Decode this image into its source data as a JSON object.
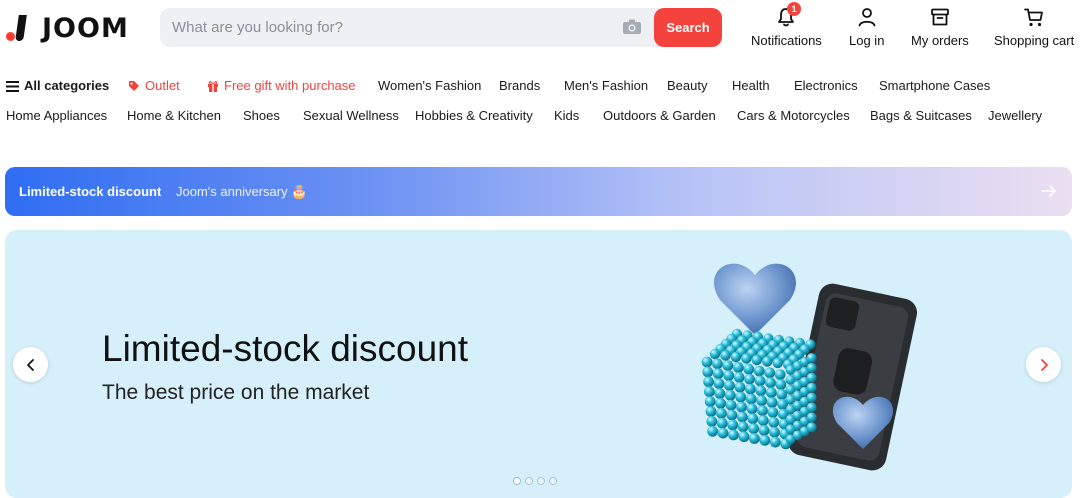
{
  "header": {
    "logo_text": "JOOM",
    "search": {
      "placeholder": "What are you looking for?",
      "button_label": "Search"
    },
    "actions": [
      {
        "label": "Notifications",
        "icon": "bell-icon",
        "badge": "1"
      },
      {
        "label": "Log in",
        "icon": "user-icon"
      },
      {
        "label": "My orders",
        "icon": "box-icon"
      },
      {
        "label": "Shopping cart",
        "icon": "cart-icon"
      }
    ]
  },
  "nav": {
    "row1": [
      {
        "label": "All categories",
        "icon": "menu-icon",
        "style": "bold"
      },
      {
        "label": "Outlet",
        "icon": "tag-icon",
        "style": "red"
      },
      {
        "label": "Free gift with purchase",
        "icon": "gift-icon",
        "style": "red"
      },
      {
        "label": "Women's Fashion"
      },
      {
        "label": "Brands"
      },
      {
        "label": "Men's Fashion"
      },
      {
        "label": "Beauty"
      },
      {
        "label": "Health"
      },
      {
        "label": "Electronics"
      },
      {
        "label": "Smartphone Cases"
      }
    ],
    "row2": [
      {
        "label": "Home Appliances"
      },
      {
        "label": "Home & Kitchen"
      },
      {
        "label": "Shoes"
      },
      {
        "label": "Sexual Wellness"
      },
      {
        "label": "Hobbies & Creativity"
      },
      {
        "label": "Kids"
      },
      {
        "label": "Outdoors & Garden"
      },
      {
        "label": "Cars & Motorcycles"
      },
      {
        "label": "Bags & Suitcases"
      },
      {
        "label": "Jewellery"
      }
    ]
  },
  "promo_strip": {
    "title": "Limited-stock discount",
    "subtitle": "Joom's anniversary 🎂"
  },
  "banner": {
    "title": "Limited-stock discount",
    "subtitle": "The best price on the market",
    "slide_count": 4,
    "active_slide": 1
  },
  "colors": {
    "accent": "#f4433c",
    "banner_bg": "#d6f0fb",
    "strip_start": "#2f6df2"
  }
}
